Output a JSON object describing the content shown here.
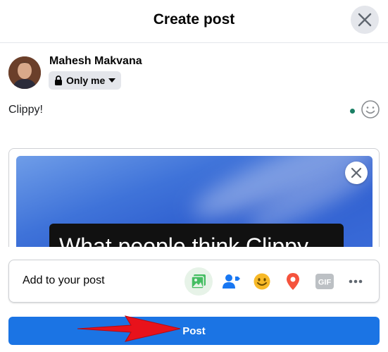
{
  "dialog": {
    "title": "Create post"
  },
  "user": {
    "name": "Mahesh Makvana",
    "audience": "Only me"
  },
  "composer": {
    "text": "Clippy!"
  },
  "preview": {
    "caption": "What people think Clippy"
  },
  "add_bar": {
    "label": "Add to your post"
  },
  "icons": {
    "close": "close-icon",
    "lock": "lock-icon",
    "dropdown": "caret-down-icon",
    "emoji": "emoji-icon",
    "remove": "close-icon",
    "photo": "photo-video-icon",
    "tag": "tag-people-icon",
    "feeling": "feeling-icon",
    "location": "location-pin-icon",
    "gif": "gif-icon",
    "more": "more-icon"
  },
  "tools": {
    "gif_label": "GIF"
  },
  "post_button": {
    "label": "Post"
  },
  "colors": {
    "primary": "#1b74e4",
    "arrow": "#e8121b",
    "photo": "#45bd62",
    "tag": "#1877f2",
    "feeling": "#f7b928",
    "location": "#f5533d"
  }
}
